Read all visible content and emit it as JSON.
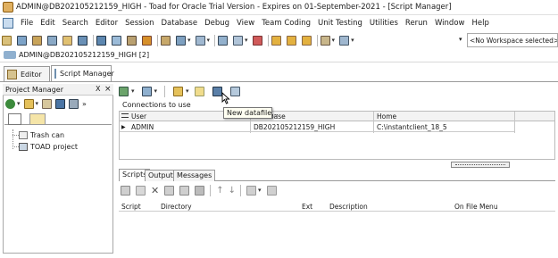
{
  "window": {
    "title": "ADMIN@DB202105212159_HIGH - Toad for Oracle Trial Version - Expires on 01-September-2021 - [Script Manager]"
  },
  "menu": [
    "File",
    "Edit",
    "Search",
    "Editor",
    "Session",
    "Database",
    "Debug",
    "View",
    "Team Coding",
    "Unit Testing",
    "Utilities",
    "Rerun",
    "Window",
    "Help"
  ],
  "workspace": {
    "value": "<No Workspace selected>"
  },
  "connection": {
    "label": "ADMIN@DB202105212159_HIGH [2]"
  },
  "window_tabs": [
    "Editor",
    "Script Manager"
  ],
  "project_manager": {
    "title": "Project Manager",
    "tree": [
      "Trash can",
      "TOAD project"
    ]
  },
  "script_manager": {
    "connections_label": "Connections to use",
    "tooltip": "New datafile...",
    "grid": {
      "columns": [
        "User",
        "Database",
        "Home"
      ],
      "rows": [
        {
          "user": "ADMIN",
          "database": "DB202105212159_HIGH",
          "home": "C:\\instantclient_18_5"
        }
      ]
    },
    "bottom_tabs": [
      "Scripts",
      "Output",
      "Messages"
    ],
    "scripts_columns": [
      "Script",
      "Directory",
      "Ext",
      "Description",
      "On File Menu"
    ]
  },
  "icons": {
    "title": "toad-app-icon",
    "pin": "pin-icon",
    "close": "close-icon"
  }
}
